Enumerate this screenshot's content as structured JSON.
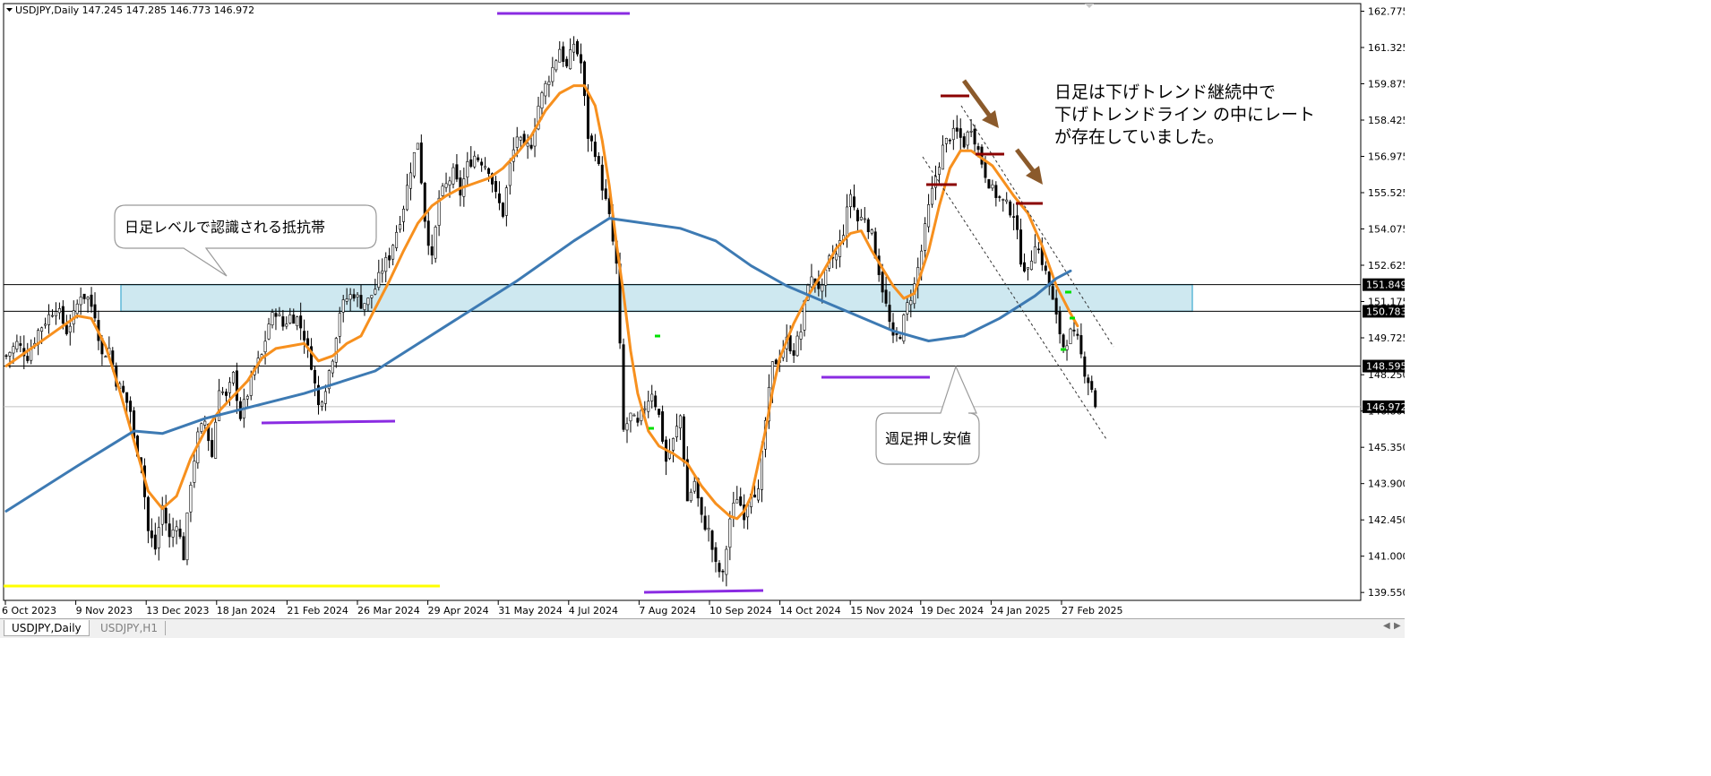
{
  "window": {
    "symbol_header": "USDJPY,Daily  147.245 147.285 146.773 146.972",
    "tabs": [
      {
        "label": "USDJPY,Daily",
        "active": true
      },
      {
        "label": "USDJPY,H1",
        "active": false
      }
    ]
  },
  "chart_data": {
    "type": "candlestick",
    "symbol": "USDJPY",
    "timeframe": "Daily",
    "ohlc_header": {
      "open": 147.245,
      "high": 147.285,
      "low": 146.773,
      "close": 146.972
    },
    "ylim": [
      139.0,
      163.0
    ],
    "y_ticks": [
      "162.775",
      "161.325",
      "159.875",
      "158.425",
      "156.975",
      "155.525",
      "154.075",
      "152.625",
      "151.175",
      "149.725",
      "148.250",
      "146.800",
      "145.350",
      "143.900",
      "142.450",
      "141.000",
      "139.550"
    ],
    "x_ticks": [
      "6 Oct 2023",
      "9 Nov 2023",
      "13 Dec 2023",
      "18 Jan 2024",
      "21 Feb 2024",
      "26 Mar 2024",
      "29 Apr 2024",
      "31 May 2024",
      "4 Jul 2024",
      "7 Aug 2024",
      "10 Sep 2024",
      "14 Oct 2024",
      "15 Nov 2024",
      "19 Dec 2024",
      "24 Jan 2025",
      "27 Feb 2025"
    ],
    "price_labels": [
      {
        "text": "151.849",
        "value": 151.849
      },
      {
        "text": "150.783",
        "value": 150.783
      },
      {
        "text": "148.595",
        "value": 148.595
      },
      {
        "text": "146.972",
        "value": 146.972,
        "current": true
      }
    ],
    "close_anchors": [
      [
        0,
        149.0
      ],
      [
        3,
        149.5
      ],
      [
        6,
        149.0
      ],
      [
        9,
        150.0
      ],
      [
        11,
        150.4
      ],
      [
        14,
        151.0
      ],
      [
        17,
        150.0
      ],
      [
        19,
        150.6
      ],
      [
        21,
        151.5
      ],
      [
        23,
        151.3
      ],
      [
        25,
        150.7
      ],
      [
        27,
        149.0
      ],
      [
        29,
        149.3
      ],
      [
        31,
        148.0
      ],
      [
        33,
        147.5
      ],
      [
        35,
        146.8
      ],
      [
        36,
        145.6
      ],
      [
        38,
        144.8
      ],
      [
        40,
        142.0
      ],
      [
        42,
        141.3
      ],
      [
        44,
        143.0
      ],
      [
        46,
        141.7
      ],
      [
        48,
        142.4
      ],
      [
        50,
        141.0
      ],
      [
        52,
        144.0
      ],
      [
        54,
        145.8
      ],
      [
        56,
        146.4
      ],
      [
        58,
        145.0
      ],
      [
        60,
        147.8
      ],
      [
        62,
        147.3
      ],
      [
        64,
        148.2
      ],
      [
        66,
        146.6
      ],
      [
        68,
        147.5
      ],
      [
        70,
        148.5
      ],
      [
        72,
        149.0
      ],
      [
        74,
        150.3
      ],
      [
        76,
        150.8
      ],
      [
        78,
        150.2
      ],
      [
        80,
        150.6
      ],
      [
        82,
        150.5
      ],
      [
        84,
        149.8
      ],
      [
        86,
        148.7
      ],
      [
        88,
        147.0
      ],
      [
        90,
        147.8
      ],
      [
        92,
        149.0
      ],
      [
        94,
        150.8
      ],
      [
        96,
        151.3
      ],
      [
        98,
        151.5
      ],
      [
        100,
        151.1
      ],
      [
        102,
        151.2
      ],
      [
        104,
        151.7
      ],
      [
        106,
        152.5
      ],
      [
        108,
        153.0
      ],
      [
        110,
        154.0
      ],
      [
        112,
        155.0
      ],
      [
        114,
        156.5
      ],
      [
        116,
        157.6
      ],
      [
        118,
        154.5
      ],
      [
        120,
        152.8
      ],
      [
        122,
        155.3
      ],
      [
        124,
        155.8
      ],
      [
        126,
        156.3
      ],
      [
        128,
        155.5
      ],
      [
        130,
        156.6
      ],
      [
        132,
        157.0
      ],
      [
        134,
        156.8
      ],
      [
        136,
        156.5
      ],
      [
        138,
        155.4
      ],
      [
        140,
        154.7
      ],
      [
        142,
        156.6
      ],
      [
        144,
        157.8
      ],
      [
        146,
        157.2
      ],
      [
        148,
        157.5
      ],
      [
        150,
        159.0
      ],
      [
        152,
        159.8
      ],
      [
        154,
        160.5
      ],
      [
        156,
        161.3
      ],
      [
        158,
        160.5
      ],
      [
        160,
        161.5
      ],
      [
        162,
        160.7
      ],
      [
        164,
        157.8
      ],
      [
        166,
        157.2
      ],
      [
        168,
        155.8
      ],
      [
        170,
        154.5
      ],
      [
        172,
        152.6
      ],
      [
        174,
        146.0
      ],
      [
        176,
        146.6
      ],
      [
        178,
        146.2
      ],
      [
        180,
        147.0
      ],
      [
        182,
        147.6
      ],
      [
        184,
        146.6
      ],
      [
        186,
        144.8
      ],
      [
        188,
        145.6
      ],
      [
        190,
        146.6
      ],
      [
        192,
        143.2
      ],
      [
        194,
        144.0
      ],
      [
        196,
        142.5
      ],
      [
        198,
        142.0
      ],
      [
        200,
        140.6
      ],
      [
        202,
        140.2
      ],
      [
        204,
        142.5
      ],
      [
        206,
        143.4
      ],
      [
        208,
        142.7
      ],
      [
        210,
        143.7
      ],
      [
        212,
        143.5
      ],
      [
        214,
        146.4
      ],
      [
        216,
        148.6
      ],
      [
        218,
        149.0
      ],
      [
        220,
        149.6
      ],
      [
        222,
        149.2
      ],
      [
        224,
        150.0
      ],
      [
        226,
        152.0
      ],
      [
        228,
        152.0
      ],
      [
        230,
        151.6
      ],
      [
        232,
        152.8
      ],
      [
        234,
        153.0
      ],
      [
        236,
        154.0
      ],
      [
        238,
        155.5
      ],
      [
        240,
        154.4
      ],
      [
        242,
        154.6
      ],
      [
        244,
        153.8
      ],
      [
        246,
        152.4
      ],
      [
        248,
        151.0
      ],
      [
        250,
        149.6
      ],
      [
        252,
        149.9
      ],
      [
        254,
        151.0
      ],
      [
        256,
        151.8
      ],
      [
        258,
        153.2
      ],
      [
        260,
        154.9
      ],
      [
        262,
        156.2
      ],
      [
        264,
        157.3
      ],
      [
        266,
        157.8
      ],
      [
        268,
        157.9
      ],
      [
        270,
        157.5
      ],
      [
        272,
        158.2
      ],
      [
        274,
        157.2
      ],
      [
        276,
        156.3
      ],
      [
        278,
        155.6
      ],
      [
        280,
        155.3
      ],
      [
        282,
        155.0
      ],
      [
        284,
        154.7
      ],
      [
        286,
        152.9
      ],
      [
        288,
        152.3
      ],
      [
        290,
        153.6
      ],
      [
        292,
        152.8
      ],
      [
        294,
        151.8
      ],
      [
        296,
        150.5
      ],
      [
        298,
        149.4
      ],
      [
        300,
        149.9
      ],
      [
        302,
        149.6
      ],
      [
        304,
        148.4
      ],
      [
        306,
        147.7
      ],
      [
        307,
        146.97
      ]
    ],
    "series": [
      {
        "name": "",
        "type": "moving-average",
        "color": "#f7901e",
        "values": [
          [
            0,
            148.6
          ],
          [
            7,
            149.3
          ],
          [
            14,
            150.0
          ],
          [
            20,
            150.6
          ],
          [
            24,
            150.5
          ],
          [
            28,
            149.4
          ],
          [
            32,
            147.6
          ],
          [
            36,
            145.6
          ],
          [
            40,
            143.6
          ],
          [
            44,
            142.9
          ],
          [
            48,
            143.4
          ],
          [
            52,
            144.9
          ],
          [
            56,
            146.0
          ],
          [
            60,
            146.8
          ],
          [
            64,
            147.4
          ],
          [
            68,
            148.0
          ],
          [
            72,
            148.9
          ],
          [
            76,
            149.3
          ],
          [
            80,
            149.4
          ],
          [
            84,
            149.5
          ],
          [
            88,
            148.8
          ],
          [
            92,
            149.0
          ],
          [
            96,
            149.5
          ],
          [
            100,
            149.8
          ],
          [
            104,
            150.9
          ],
          [
            108,
            152.0
          ],
          [
            112,
            153.2
          ],
          [
            116,
            154.3
          ],
          [
            120,
            155.0
          ],
          [
            124,
            155.4
          ],
          [
            128,
            155.7
          ],
          [
            132,
            155.9
          ],
          [
            136,
            156.1
          ],
          [
            140,
            156.5
          ],
          [
            144,
            157.1
          ],
          [
            148,
            157.8
          ],
          [
            152,
            158.8
          ],
          [
            156,
            159.5
          ],
          [
            160,
            159.8
          ],
          [
            163,
            159.8
          ],
          [
            166,
            159.0
          ],
          [
            168,
            157.6
          ],
          [
            170,
            155.8
          ],
          [
            172,
            153.5
          ],
          [
            174,
            151.5
          ],
          [
            176,
            149.2
          ],
          [
            178,
            147.5
          ],
          [
            181,
            146.0
          ],
          [
            184,
            145.4
          ],
          [
            188,
            145.1
          ],
          [
            192,
            144.7
          ],
          [
            196,
            143.8
          ],
          [
            200,
            143.1
          ],
          [
            204,
            142.6
          ],
          [
            206,
            142.5
          ],
          [
            208,
            142.8
          ],
          [
            210,
            143.4
          ],
          [
            212,
            144.7
          ],
          [
            214,
            146.0
          ],
          [
            216,
            147.6
          ],
          [
            218,
            148.9
          ],
          [
            222,
            150.3
          ],
          [
            226,
            151.4
          ],
          [
            230,
            152.3
          ],
          [
            234,
            153.3
          ],
          [
            238,
            153.9
          ],
          [
            241,
            154.0
          ],
          [
            244,
            153.2
          ],
          [
            247,
            152.5
          ],
          [
            250,
            151.8
          ],
          [
            253,
            151.3
          ],
          [
            256,
            151.5
          ],
          [
            260,
            153.2
          ],
          [
            263,
            155.0
          ],
          [
            266,
            156.5
          ],
          [
            269,
            157.2
          ],
          [
            272,
            157.2
          ],
          [
            275,
            156.9
          ],
          [
            278,
            156.6
          ],
          [
            281,
            156.0
          ],
          [
            284,
            155.4
          ],
          [
            288,
            154.7
          ],
          [
            292,
            153.4
          ],
          [
            296,
            151.8
          ],
          [
            300,
            150.7
          ],
          [
            302,
            150.2
          ]
        ]
      },
      {
        "name": "",
        "type": "moving-average",
        "color": "#3d7ab3",
        "values": [
          [
            0,
            142.8
          ],
          [
            20,
            144.6
          ],
          [
            36,
            146.0
          ],
          [
            44,
            145.9
          ],
          [
            56,
            146.5
          ],
          [
            70,
            147.0
          ],
          [
            84,
            147.5
          ],
          [
            104,
            148.4
          ],
          [
            124,
            150.2
          ],
          [
            144,
            152.0
          ],
          [
            160,
            153.6
          ],
          [
            170,
            154.5
          ],
          [
            175,
            154.4
          ],
          [
            190,
            154.1
          ],
          [
            200,
            153.6
          ],
          [
            210,
            152.6
          ],
          [
            220,
            151.8
          ],
          [
            230,
            151.2
          ],
          [
            240,
            150.6
          ],
          [
            250,
            150.0
          ],
          [
            260,
            149.6
          ],
          [
            270,
            149.8
          ],
          [
            280,
            150.5
          ],
          [
            290,
            151.4
          ],
          [
            296,
            152.1
          ],
          [
            300,
            152.4
          ]
        ]
      }
    ],
    "resistance_zone": {
      "high": 151.849,
      "low": 150.783
    },
    "horizontal_lines": [
      151.849,
      150.783,
      148.595
    ],
    "annotations": [
      {
        "text": "日足レベルで認識される抵抗帯"
      },
      {
        "text": "週足押し安値"
      },
      {
        "lines": [
          "日足は下げトレンド継続中で",
          "下げトレンドライン の中にレート",
          "が存在していました。"
        ]
      }
    ]
  }
}
